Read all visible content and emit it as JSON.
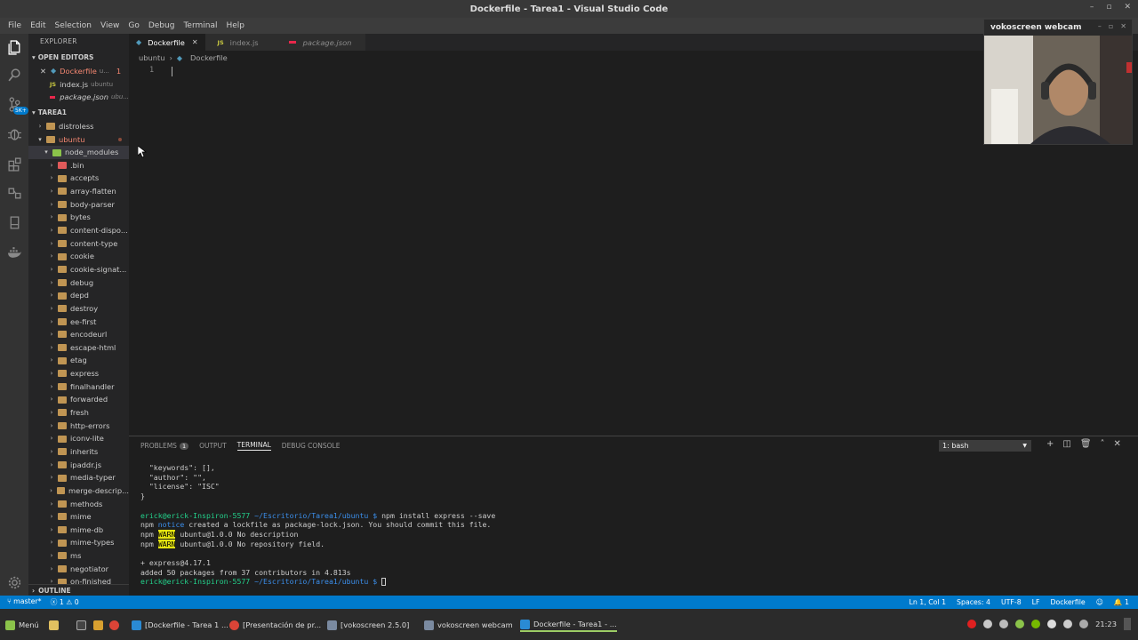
{
  "window": {
    "title": "Dockerfile - Tarea1 - Visual Studio Code"
  },
  "menu": [
    "File",
    "Edit",
    "Selection",
    "View",
    "Go",
    "Debug",
    "Terminal",
    "Help"
  ],
  "explorer": {
    "header": "EXPLORER",
    "open_editors_label": "OPEN EDITORS",
    "open_editors": [
      {
        "name": "Dockerfile",
        "hint": "u...",
        "badge": "1"
      },
      {
        "name": "index.js",
        "hint": "ubuntu"
      },
      {
        "name": "package.json",
        "hint": "ubu..."
      }
    ],
    "workspace_label": "TAREA1",
    "folders": [
      "distroless",
      "ubuntu",
      "node_modules"
    ],
    "modules": [
      ".bin",
      "accepts",
      "array-flatten",
      "body-parser",
      "bytes",
      "content-dispo...",
      "content-type",
      "cookie",
      "cookie-signat...",
      "debug",
      "depd",
      "destroy",
      "ee-first",
      "encodeurl",
      "escape-html",
      "etag",
      "express",
      "finalhandler",
      "forwarded",
      "fresh",
      "http-errors",
      "iconv-lite",
      "inherits",
      "ipaddr.js",
      "media-typer",
      "merge-descrip...",
      "methods",
      "mime",
      "mime-db",
      "mime-types",
      "ms",
      "negotiator",
      "on-finished"
    ],
    "outline_label": "OUTLINE"
  },
  "tabs": [
    {
      "label": "Dockerfile",
      "active": true
    },
    {
      "label": "index.js",
      "active": false
    },
    {
      "label": "package.json",
      "active": false
    }
  ],
  "breadcrumb": {
    "folder": "ubuntu",
    "file": "Dockerfile"
  },
  "editor": {
    "line_number": "1"
  },
  "panel": {
    "tabs": {
      "problems": "PROBLEMS",
      "problems_count": "1",
      "output": "OUTPUT",
      "terminal": "TERMINAL",
      "debug": "DEBUG CONSOLE"
    },
    "terminal_select": "1: bash",
    "lines": {
      "l1": "  \"keywords\": [],",
      "l2": "  \"author\": \"\",",
      "l3": "  \"license\": \"ISC\"",
      "l4": "}",
      "prompt_user": "erick@erick-Inspiron-5577",
      "prompt_path": "~/Escritorio/Tarea1/ubuntu $",
      "cmd": " npm install express --save",
      "npm": "npm",
      "notice": "notice",
      "notice_text": " created a lockfile as package-lock.json. You should commit this file.",
      "warn": "WARN",
      "warn1": " ubuntu@1.0.0 No description",
      "warn2": " ubuntu@1.0.0 No repository field.",
      "added_pkg": "+ express@4.17.1",
      "added": "added 50 packages from 37 contributors in 4.813s"
    }
  },
  "status": {
    "branch": "master*",
    "problems": "1",
    "warnings": "0",
    "position": "Ln 1, Col 1",
    "spaces": "Spaces: 4",
    "encoding": "UTF-8",
    "eol": "LF",
    "language": "Dockerfile",
    "bell": "1"
  },
  "taskbar": {
    "menu": "Menú",
    "items": [
      "[Dockerfile - Tarea 1 ...",
      "[Presentación de pr...",
      "[vokoscreen 2.5.0]",
      "vokoscreen webcam",
      "Dockerfile - Tarea1 - ..."
    ],
    "clock": "21:23"
  },
  "webcam": {
    "title": "vokoscreen webcam"
  },
  "colors": {
    "accent": "#007acc",
    "terminal_green": "#23d18b",
    "terminal_blue": "#3b8eea",
    "warn_bg": "#e5e510"
  }
}
